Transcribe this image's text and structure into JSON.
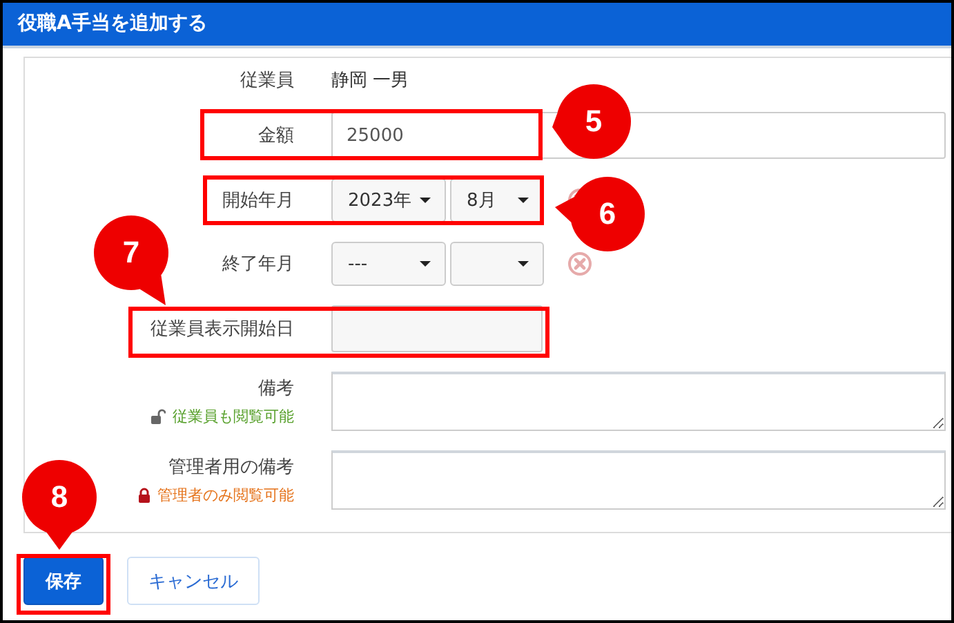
{
  "window": {
    "title": "役職A手当を追加する"
  },
  "form": {
    "employee": {
      "label": "従業員",
      "value": "静岡 一男"
    },
    "amount": {
      "label": "金額",
      "value": "25000"
    },
    "start_month": {
      "label": "開始年月",
      "year": "2023年",
      "month": "8月"
    },
    "end_month": {
      "label": "終了年月",
      "year": "---"
    },
    "display_start_date": {
      "label": "従業員表示開始日",
      "disabled": true
    },
    "note": {
      "label": "備考",
      "visibility": "従業員も閲覧可能",
      "locked": false
    },
    "admin_note": {
      "label": "管理者用の備考",
      "visibility": "管理者のみ閲覧可能",
      "locked": true
    }
  },
  "buttons": [
    {
      "label": "保存",
      "kind": "primary"
    },
    {
      "label": "キャンセル",
      "kind": "secondary"
    }
  ],
  "annotations": [
    {
      "number": "5"
    },
    {
      "number": "6"
    },
    {
      "number": "7"
    },
    {
      "number": "8"
    }
  ]
}
